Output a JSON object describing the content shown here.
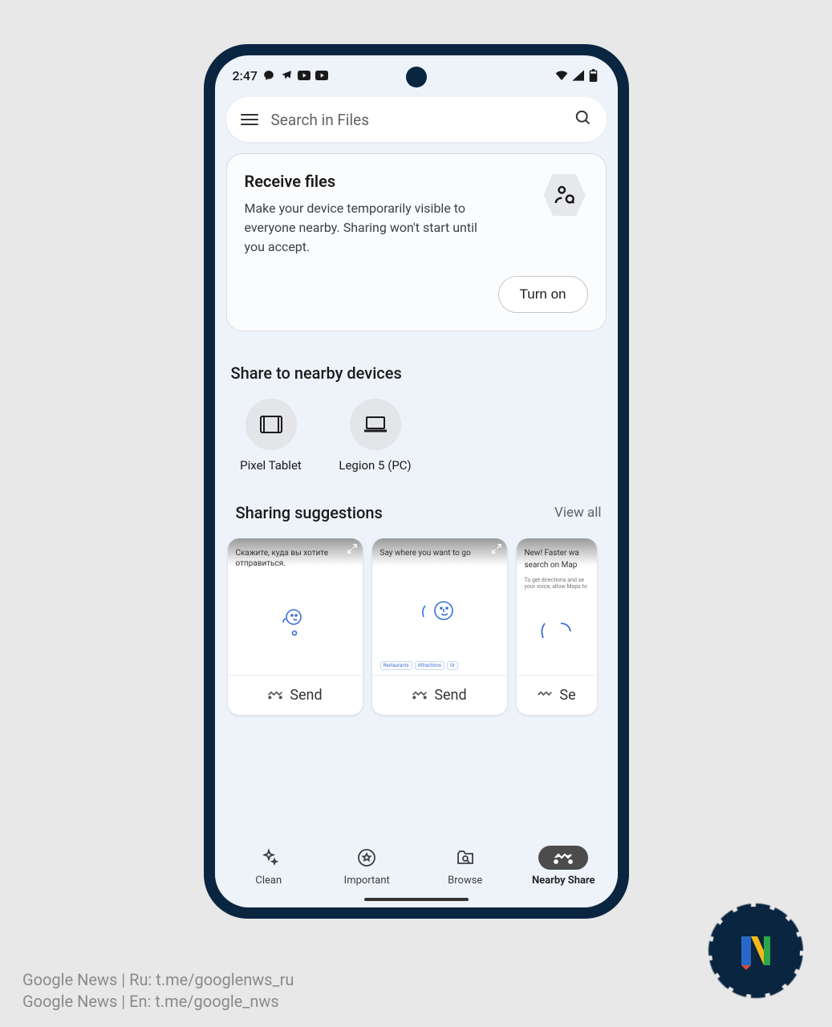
{
  "status": {
    "time": "2:47"
  },
  "search": {
    "placeholder": "Search in Files"
  },
  "receive": {
    "title": "Receive files",
    "description": "Make your device temporarily visible to everyone nearby. Sharing won't start until you accept.",
    "button": "Turn on"
  },
  "share_section": {
    "title": "Share to nearby devices",
    "devices": [
      {
        "label": "Pixel Tablet",
        "type": "tablet"
      },
      {
        "label": "Legion 5 (PC)",
        "type": "laptop"
      }
    ]
  },
  "suggestions": {
    "title": "Sharing suggestions",
    "view_all": "View all",
    "cards": [
      {
        "preview_text": "Скажите, куда вы хотите отправиться.",
        "chips": [],
        "send": "Send"
      },
      {
        "preview_text": "Say where you want to go",
        "chips": [
          "Restaurants",
          "Attractions",
          "Gr"
        ],
        "send": "Send"
      },
      {
        "preview_text": "New! Faster wa",
        "preview_sub": "search on Map",
        "preview_sub2": "To get directions and se your voice, allow Maps to",
        "chips": [],
        "send": "Se"
      }
    ]
  },
  "nav": {
    "items": [
      {
        "label": "Clean"
      },
      {
        "label": "Important"
      },
      {
        "label": "Browse"
      },
      {
        "label": "Nearby Share"
      }
    ],
    "active_index": 3
  },
  "watermark": {
    "line1": "Google News | Ru: t.me/googlenws_ru",
    "line2": "Google News | En: t.me/google_nws"
  }
}
